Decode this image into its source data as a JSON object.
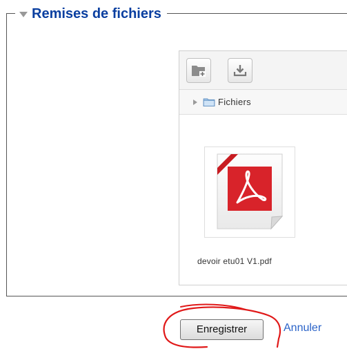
{
  "section": {
    "title": "Remises de fichiers"
  },
  "filemanager": {
    "path_label": "Fichiers",
    "toolbar": {
      "add_icon": "folder-add-icon",
      "download_icon": "download-icon"
    },
    "files": [
      {
        "name": "devoir etu01 V1.pdf",
        "icon": "pdf-file-icon"
      }
    ]
  },
  "actions": {
    "save_label": "Enregistrer",
    "cancel_label": "Annuler"
  },
  "colors": {
    "legend_title": "#0a3fa0",
    "link": "#2b63c8",
    "annotation": "#e01818",
    "pdf_red": "#d8232a"
  }
}
